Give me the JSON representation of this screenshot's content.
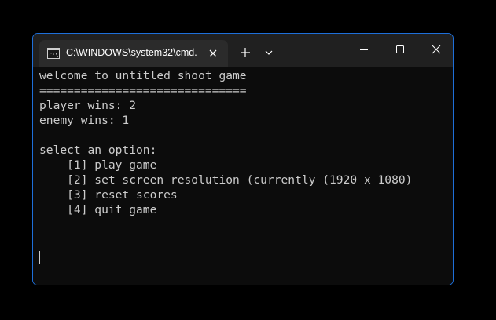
{
  "window": {
    "tab_title": "C:\\WINDOWS\\system32\\cmd.",
    "tab_icon": "cmd-icon",
    "accent_color": "#1e6fd9",
    "background_color": "#0c0c0c",
    "text_color": "#cccccc"
  },
  "console": {
    "lines": [
      "welcome to untitled shoot game",
      "==============================",
      "player wins: 2",
      "enemy wins: 1",
      "",
      "select an option:",
      "    [1] play game",
      "    [2] set screen resolution (currently (1920 x 1080)",
      "    [3] reset scores",
      "    [4] quit game"
    ]
  }
}
